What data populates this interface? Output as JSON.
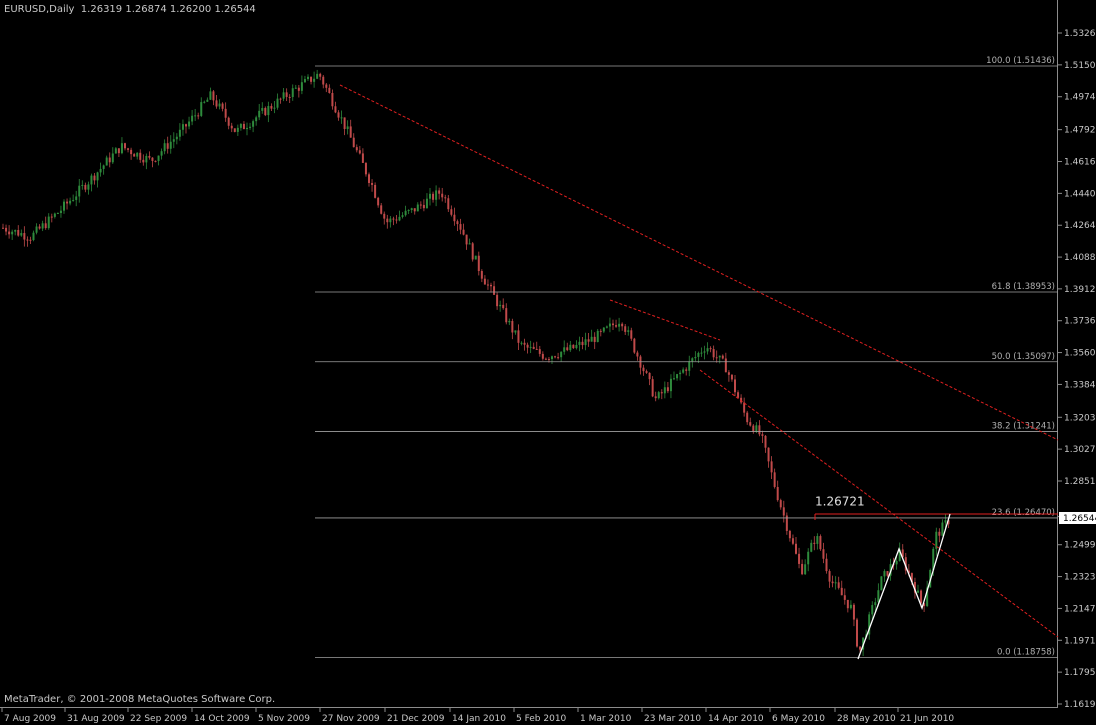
{
  "window": {
    "symbol": "EURUSD,Daily",
    "open": "1.26319",
    "high": "1.26874",
    "low": "1.26200",
    "close": "1.26544",
    "copyright": "MetaTrader, © 2001-2008 MetaQuotes Software Corp."
  },
  "chart_data": {
    "type": "candlestick",
    "price_axis": [
      "1.53260",
      "1.51500",
      "1.49740",
      "1.47920",
      "1.46160",
      "1.44400",
      "1.42640",
      "1.40880",
      "1.39125",
      "1.37365",
      "1.35605",
      "1.33845",
      "1.32030",
      "1.30270",
      "1.28510",
      "1.26544",
      "1.24990",
      "1.23230",
      "1.21470",
      "1.19710",
      "1.17950",
      "1.16190"
    ],
    "price_axis_values": [
      1.5326,
      1.515,
      1.4974,
      1.4792,
      1.4616,
      1.444,
      1.4264,
      1.4088,
      1.39125,
      1.37365,
      1.35605,
      1.33845,
      1.3203,
      1.3027,
      1.2851,
      1.26544,
      1.2499,
      1.2323,
      1.2147,
      1.1971,
      1.1795,
      1.1619
    ],
    "current_price": "1.26544",
    "ylim": [
      1.1619,
      1.5326
    ],
    "date_axis": [
      "7 Aug 2009",
      "31 Aug 2009",
      "22 Sep 2009",
      "14 Oct 2009",
      "5 Nov 2009",
      "27 Nov 2009",
      "21 Dec 2009",
      "14 Jan 2010",
      "5 Feb 2010",
      "1 Mar 2010",
      "23 Mar 2010",
      "14 Apr 2010",
      "6 May 2010",
      "28 May 2010",
      "21 Jun 2010"
    ],
    "fibonacci": [
      {
        "label": "100.0 (1.51436)",
        "price": 1.51436
      },
      {
        "label": "61.8 (1.38953)",
        "price": 1.38953
      },
      {
        "label": "50.0 (1.35097)",
        "price": 1.35097
      },
      {
        "label": "38.2 (1.31241)",
        "price": 1.31241
      },
      {
        "label": "23.6 (1.26470)",
        "price": 1.2647
      },
      {
        "label": "0.0 (1.18758)",
        "price": 1.18758
      }
    ],
    "annotation": "1.26721",
    "annotation_price": 1.26721,
    "colors": {
      "background": "#000000",
      "bull": "#2e8b3c",
      "bear": "#c04a4a",
      "trendline": "#e02020",
      "fib": "#a0a0a0",
      "pattern": "#ffffff"
    }
  }
}
